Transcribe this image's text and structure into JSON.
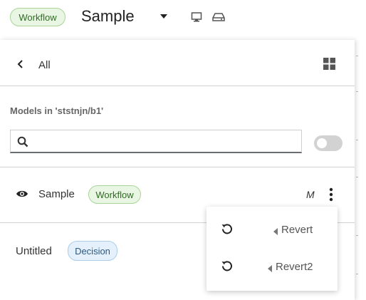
{
  "header": {
    "badge": "Workflow",
    "title": "Sample"
  },
  "panel": {
    "back_label": "All",
    "section_label": "Models in 'ststnjn/b1'",
    "search": {
      "value": "",
      "placeholder": ""
    },
    "models": [
      {
        "name": "Sample",
        "badge": "Workflow",
        "modified_marker": "M"
      },
      {
        "name": "Untitled",
        "badge": "Decision"
      }
    ]
  },
  "menu": {
    "items": [
      {
        "label": "Revert"
      },
      {
        "label": "Revert2"
      }
    ]
  }
}
